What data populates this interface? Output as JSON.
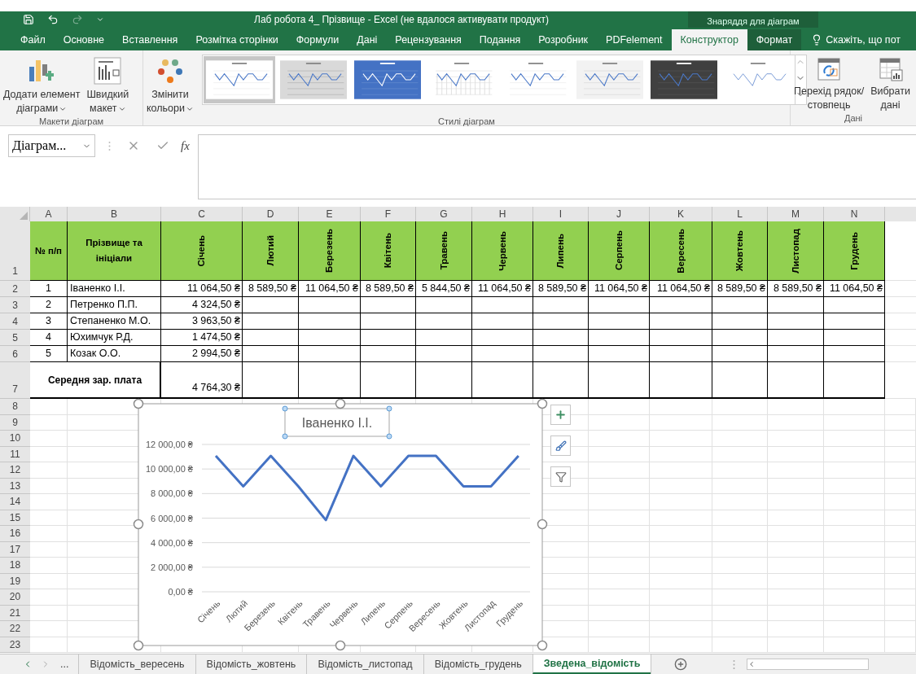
{
  "window": {
    "title": "Лаб робота 4_ Прізвище - Excel (не вдалося активувати продукт)",
    "context_label": "Знаряддя для діаграм"
  },
  "ribbon_tabs": [
    {
      "label": "Файл",
      "selected": false,
      "contextual": false
    },
    {
      "label": "Основне",
      "selected": false,
      "contextual": false
    },
    {
      "label": "Вставлення",
      "selected": false,
      "contextual": false
    },
    {
      "label": "Розмітка сторінки",
      "selected": false,
      "contextual": false
    },
    {
      "label": "Формули",
      "selected": false,
      "contextual": false
    },
    {
      "label": "Дані",
      "selected": false,
      "contextual": false
    },
    {
      "label": "Рецензування",
      "selected": false,
      "contextual": false
    },
    {
      "label": "Подання",
      "selected": false,
      "contextual": false
    },
    {
      "label": "Розробник",
      "selected": false,
      "contextual": false
    },
    {
      "label": "PDFelement",
      "selected": false,
      "contextual": false
    },
    {
      "label": "Конструктор",
      "selected": true,
      "contextual": true
    },
    {
      "label": "Формат",
      "selected": false,
      "contextual": true
    }
  ],
  "tell_me": "Скажіть, що пот",
  "ribbon": {
    "layouts_group": {
      "label": "Макети діаграм",
      "buttons": [
        {
          "kind": "add-element",
          "lines": [
            "Додати елемент",
            "діаграми"
          ],
          "dropdown": true
        },
        {
          "kind": "quick-layout",
          "lines": [
            "Швидкий",
            "макет"
          ],
          "dropdown": true
        }
      ]
    },
    "styles_group": {
      "label": "Стилі діаграм",
      "colors_button": {
        "lines": [
          "Змінити",
          "кольори"
        ],
        "dropdown": true
      },
      "styles": [
        {
          "kind": "light",
          "selected": true
        },
        {
          "kind": "gray",
          "selected": false
        },
        {
          "kind": "blue",
          "selected": false
        },
        {
          "kind": "columns",
          "selected": false
        },
        {
          "kind": "light",
          "selected": false
        },
        {
          "kind": "hatched",
          "selected": false
        },
        {
          "kind": "dark",
          "selected": false
        },
        {
          "kind": "dots",
          "selected": false
        }
      ]
    },
    "data_group": {
      "label": "Дані",
      "buttons": [
        {
          "kind": "switch",
          "lines": [
            "Перехід рядок/",
            "стовпець"
          ]
        },
        {
          "kind": "select-data",
          "lines": [
            "Вибрати",
            "дані"
          ]
        }
      ]
    }
  },
  "formula_bar": {
    "name_box": "Діаграм...",
    "fx": "fx"
  },
  "sheet": {
    "columns": [
      "A",
      "B",
      "C",
      "D",
      "E",
      "F",
      "G",
      "H",
      "I",
      "J",
      "K",
      "L",
      "M",
      "N"
    ],
    "header_row": {
      "number": "1",
      "cells": [
        {
          "text": "№ п/п",
          "kind": "horizontal"
        },
        {
          "text": "Прізвище та ініціали",
          "kind": "horizontal"
        },
        {
          "text": "Січень",
          "kind": "vertical"
        },
        {
          "text": "Лютий",
          "kind": "vertical"
        },
        {
          "text": "Березень",
          "kind": "vertical"
        },
        {
          "text": "Квітень",
          "kind": "vertical"
        },
        {
          "text": "Травень",
          "kind": "vertical"
        },
        {
          "text": "Червень",
          "kind": "vertical"
        },
        {
          "text": "Липень",
          "kind": "vertical"
        },
        {
          "text": "Серпень",
          "kind": "vertical"
        },
        {
          "text": "Вересень",
          "kind": "vertical"
        },
        {
          "text": "Жовтень",
          "kind": "vertical"
        },
        {
          "text": "Листопад",
          "kind": "vertical"
        },
        {
          "text": "Грудень",
          "kind": "vertical"
        }
      ]
    },
    "rows": [
      {
        "number": "2",
        "cells": [
          "1",
          "Іваненко І.І.",
          "11 064,50 ₴",
          "8 589,50 ₴",
          "11 064,50 ₴",
          "8 589,50 ₴",
          "5 844,50 ₴",
          "11 064,50 ₴",
          "8 589,50 ₴",
          "11 064,50 ₴",
          "11 064,50 ₴",
          "8 589,50 ₴",
          "8 589,50 ₴",
          "11 064,50 ₴"
        ]
      },
      {
        "number": "3",
        "cells": [
          "2",
          "Петренко П.П.",
          "4 324,50 ₴"
        ]
      },
      {
        "number": "4",
        "cells": [
          "3",
          "Степаненко М.О.",
          "3 963,50 ₴"
        ]
      },
      {
        "number": "5",
        "cells": [
          "4",
          "Юхимчук Р.Д.",
          "1 474,50 ₴"
        ]
      },
      {
        "number": "6",
        "cells": [
          "5",
          "Козак О.О.",
          "2 994,50 ₴"
        ]
      }
    ],
    "summary_row": {
      "number": "7",
      "label": "Середня зар. плата",
      "value": "4 764,30 ₴"
    },
    "empty_rows": [
      "8",
      "9",
      "10",
      "11",
      "12",
      "13",
      "14",
      "15",
      "16",
      "17",
      "18",
      "19",
      "20",
      "21",
      "22",
      "23"
    ]
  },
  "chart": {
    "chart_data": {
      "type": "line",
      "title": "Іваненко І.І.",
      "categories": [
        "Січень",
        "Лютий",
        "Березень",
        "Квітень",
        "Травень",
        "Червень",
        "Липень",
        "Серпень",
        "Вересень",
        "Жовтень",
        "Листопад",
        "Грудень"
      ],
      "series": [
        {
          "color": "#4472c4",
          "values": [
            11064.5,
            8589.5,
            11064.5,
            8589.5,
            5844.5,
            11064.5,
            8589.5,
            11064.5,
            11064.5,
            8589.5,
            8589.5,
            11064.5
          ]
        }
      ],
      "ylim": [
        0,
        12000
      ],
      "grid": true,
      "yticks": [
        {
          "value": 0,
          "label": "0,00 ₴"
        },
        {
          "value": 2000,
          "label": "2 000,00 ₴"
        },
        {
          "value": 4000,
          "label": "4 000,00 ₴"
        },
        {
          "value": 6000,
          "label": "6 000,00 ₴"
        },
        {
          "value": 8000,
          "label": "8 000,00 ₴"
        },
        {
          "value": 10000,
          "label": "10 000,00 ₴"
        },
        {
          "value": 12000,
          "label": "12 000,00 ₴"
        }
      ]
    }
  },
  "sheet_tabs": {
    "more": "...",
    "tabs": [
      {
        "label": "Відомість_вересень",
        "selected": false
      },
      {
        "label": "Відомість_жовтень",
        "selected": false
      },
      {
        "label": "Відомість_листопад",
        "selected": false
      },
      {
        "label": "Відомість_грудень",
        "selected": false
      },
      {
        "label": "Зведена_відомість",
        "selected": true
      }
    ]
  }
}
